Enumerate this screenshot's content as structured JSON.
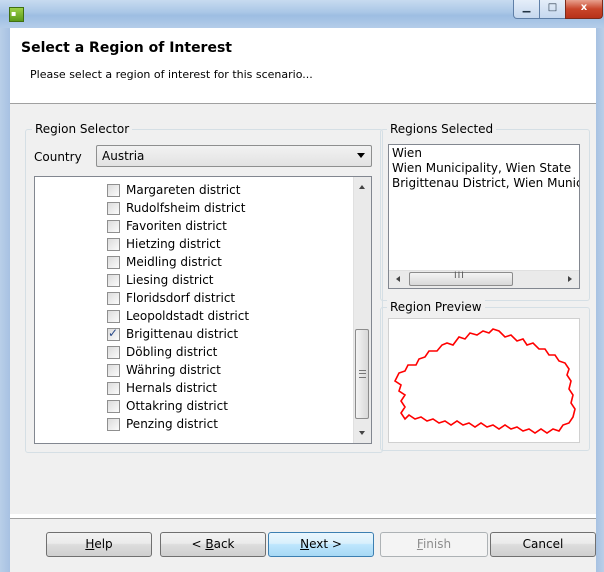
{
  "window": {
    "icon": "app-logo-icon",
    "minimize_icon": "minimize-icon",
    "maximize_icon": "maximize-icon",
    "close_label": "x"
  },
  "header": {
    "title": "Select a Region of Interest",
    "subtitle": "Please select a region of interest for this scenario..."
  },
  "region_selector": {
    "label": "Region Selector",
    "country_label": "Country",
    "country_value": "Austria",
    "items": [
      {
        "label": "Margareten district",
        "checked": false
      },
      {
        "label": "Rudolfsheim district",
        "checked": false
      },
      {
        "label": "Favoriten district",
        "checked": false
      },
      {
        "label": "Hietzing district",
        "checked": false
      },
      {
        "label": "Meidling district",
        "checked": false
      },
      {
        "label": "Liesing district",
        "checked": false
      },
      {
        "label": "Floridsdorf district",
        "checked": false
      },
      {
        "label": "Leopoldstadt district",
        "checked": false
      },
      {
        "label": "Brigittenau district",
        "checked": true
      },
      {
        "label": "Döbling district",
        "checked": false
      },
      {
        "label": "Währing district",
        "checked": false
      },
      {
        "label": "Hernals district",
        "checked": false
      },
      {
        "label": "Ottakring district",
        "checked": false
      },
      {
        "label": "Penzing district",
        "checked": false
      }
    ]
  },
  "regions_selected": {
    "label": "Regions Selected",
    "lines": [
      "Wien",
      "Wien Municipality, Wien State",
      "Brigittenau District, Wien Munici"
    ]
  },
  "region_preview": {
    "label": "Region Preview",
    "outline_color": "#ff0000"
  },
  "buttons": {
    "help": {
      "label": "elp",
      "mnemonic": "H"
    },
    "back": {
      "label": "< ",
      "mnemonic": "B",
      "rest": "ack"
    },
    "next": {
      "mnemonic": "N",
      "rest": "ext >"
    },
    "finish": {
      "mnemonic": "F",
      "rest": "inish"
    },
    "cancel": {
      "label": "Cancel"
    }
  },
  "scroll_thumb_glyph": "III"
}
